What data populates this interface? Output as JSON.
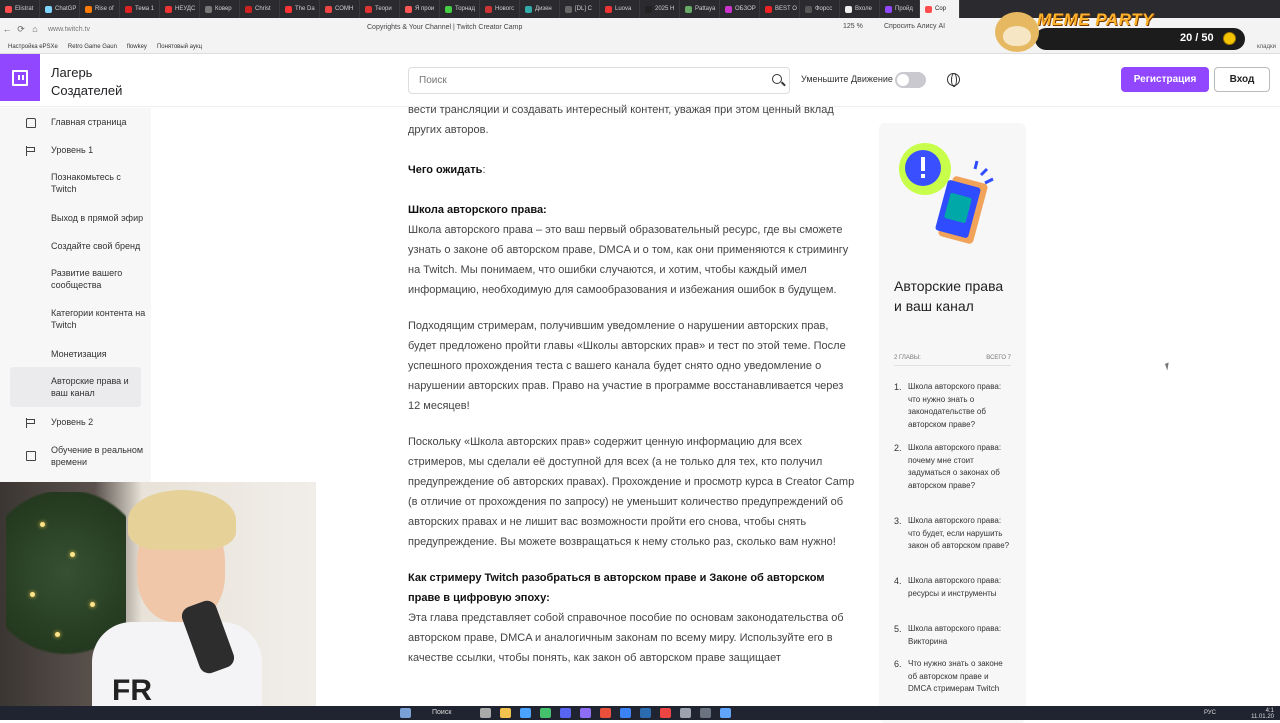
{
  "browser": {
    "tabs": [
      "Elistrat",
      "ChatGP",
      "Rise of",
      "Тема 1",
      "НЕУДС",
      "Ковер",
      "Christ",
      "The Da",
      "СОМН",
      "Теори",
      "Я прои",
      "Торнад",
      "Новогс",
      "Дизен",
      "[DL] С",
      "Luova",
      "2025 H",
      "Pattaya",
      "ОБЗОР",
      "BEST O",
      "Форсс",
      "Вхоле",
      "Пройд",
      "Сор"
    ],
    "page_title": "Copyrights & Your Channel | Twitch Creator Camp",
    "url": "www.twitch.tv",
    "zoom": "125 %",
    "alisa": "Спросить Алису AI",
    "bookmarks": [
      "Настройка ePSXe",
      "Retro Game Gaun",
      "flowkey",
      "Понятовый аукц"
    ],
    "bookmarks_right": "кладки"
  },
  "overlay": {
    "title": "MEME PARTY",
    "count": "20 / 50"
  },
  "header": {
    "brand_line1": "Лагерь",
    "brand_line2": "Создателей",
    "search_placeholder": "Поиск",
    "motion_label": "Уменьшите Движение",
    "register": "Регистрация",
    "login": "Вход"
  },
  "sidebar": {
    "items": [
      {
        "label": "Главная страница"
      },
      {
        "label": "Уровень 1"
      },
      {
        "label": "Познакомьтесь с Twitch"
      },
      {
        "label": "Выход в прямой эфир"
      },
      {
        "label": "Создайте свой бренд"
      },
      {
        "label": "Развитие вашего сообщества"
      },
      {
        "label": "Категории контента на Twitch"
      },
      {
        "label": "Монетизация"
      },
      {
        "label": "Авторские права и ваш канал"
      },
      {
        "label": "Уровень 2"
      },
      {
        "label": "Обучение в реальном времени"
      }
    ]
  },
  "article": {
    "intro": "вести трансляции и создавать интересный контент, уважая при этом ценный вклад других авторов.",
    "expect_heading": "Чего ожидать",
    "expect_colon": ":",
    "school_heading": "Школа авторского права:",
    "school_text": "Школа авторского права – это ваш первый образовательный ресурс, где вы сможете узнать о законе об авторском праве, DMCA и о том, как они применяются к стримингу на Twitch. Мы понимаем, что ошибки случаются, и хотим, чтобы каждый имел информацию, необходимую для самообразования и избежания ошибок в будущем.",
    "para2": "Подходящим стримерам, получившим уведомление о нарушении авторских прав, будет предложено пройти главы «Школы авторских прав» и тест по этой теме. После успешного прохождения теста с вашего канала будет снято одно уведомление о нарушении авторских прав. Право на участие в программе восстанавливается через 12 месяцев!",
    "para3": "Поскольку «Школа авторских прав» содержит ценную информацию для всех стримеров, мы сделали её доступной для всех (а не только для тех, кто получил предупреждение об авторских правах). Прохождение и просмотр курса в Creator Camp (в отличие от прохождения по запросу) не уменьшит количество предупреждений об авторских правах и не лишит вас возможности пройти его снова, чтобы снять предупреждение. Вы можете возвращаться к нему столько раз, сколько вам нужно!",
    "h3": "Как стримеру Twitch разобраться в авторском праве и Законе об авторском праве в цифровую эпоху:",
    "para4": "Эта глава представляет собой справочное пособие по основам законодательства об авторском праве, DMCA и аналогичным законам по всему миру. Используйте его в качестве ссылки, чтобы понять, как закон об авторском праве защищает"
  },
  "card": {
    "title": "Авторские права и ваш канал",
    "meta_left": "2 ГЛАВЫ:",
    "meta_right": "ВСЕГО 7",
    "chapters": [
      {
        "n": "1.",
        "t": "Школа авторского права: что нужно знать о законодательстве об авторском праве?"
      },
      {
        "n": "2.",
        "t": "Школа авторского права: почему мне стоит задуматься о законах об авторском праве?"
      },
      {
        "n": "3.",
        "t": "Школа авторского права: что будет, если нарушить закон об авторском праве?"
      },
      {
        "n": "4.",
        "t": "Школа авторского права: ресурсы и инструменты"
      },
      {
        "n": "5.",
        "t": "Школа авторского права: Викторина"
      },
      {
        "n": "6.",
        "t": "Что нужно знать о законе об авторском праве и DMCA стримерам Twitch"
      }
    ]
  },
  "webcam": {
    "shirt_text": "FR"
  },
  "taskbar": {
    "search": "Поиск",
    "lang": "РУС",
    "time": "4:1",
    "date": "11.01.20"
  },
  "colors": {
    "accent": "#9146ff"
  }
}
